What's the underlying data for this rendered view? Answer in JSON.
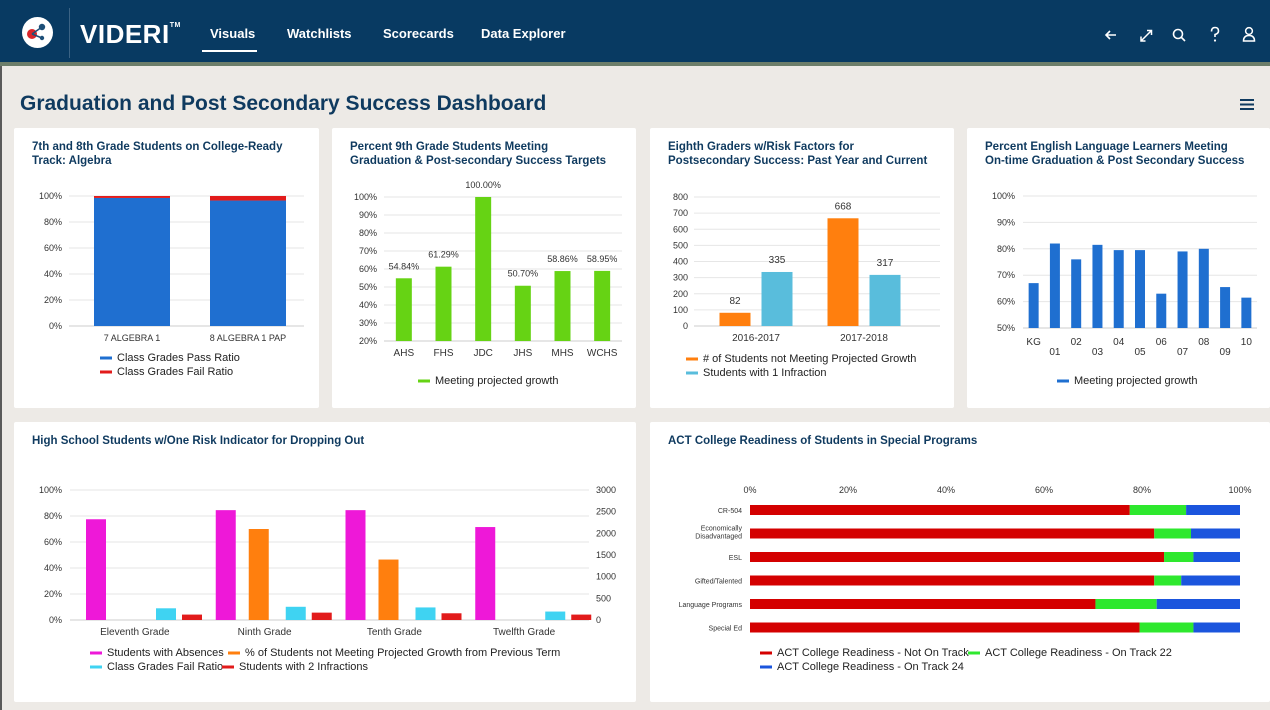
{
  "app": {
    "brand": "VIDERI",
    "trademark": "TM"
  },
  "nav": {
    "items": [
      "Visuals",
      "Watchlists",
      "Scorecards",
      "Data Explorer"
    ],
    "active": "Visuals"
  },
  "toolbar_icons": [
    "back-arrow-icon",
    "expand-icon",
    "search-icon",
    "help-icon",
    "user-icon"
  ],
  "page": {
    "title": "Graduation and Post Secondary Success Dashboard"
  },
  "colors": {
    "nav_bg": "#083a62",
    "blue": "#1f6fd0",
    "red": "#e21b1b",
    "green": "#66d314",
    "orange": "#ff7f0e",
    "teal": "#59bddc",
    "magenta": "#ee18d8",
    "cyan": "#3fd3f2"
  },
  "cards": {
    "algebra": {
      "title_lines": [
        "7th and 8th Grade Students on College-Ready",
        "Track: Algebra"
      ]
    },
    "ninth": {
      "title_lines": [
        "Percent 9th Grade Students Meeting",
        "Graduation & Post-secondary Success Targets"
      ]
    },
    "eighth": {
      "title_lines": [
        "Eighth Graders w/Risk Factors for",
        "Postsecondary Success: Past Year and Current"
      ]
    },
    "ell": {
      "title_lines": [
        "Percent English Language Learners Meeting",
        "On-time Graduation & Post Secondary Success"
      ]
    },
    "dropout": {
      "title_lines": [
        "High School Students w/One Risk Indicator for Dropping Out"
      ]
    },
    "act": {
      "title_lines": [
        "ACT College Readiness of Students in Special Programs"
      ]
    }
  },
  "chart_data": [
    {
      "id": "algebra",
      "type": "bar",
      "stacked": true,
      "categories": [
        "7 ALGEBRA 1",
        "8 ALGEBRA 1 PAP"
      ],
      "series": [
        {
          "name": "Class Grades Pass Ratio",
          "color": "#1f6fd0",
          "values": [
            98.5,
            96.5
          ]
        },
        {
          "name": "Class Grades Fail Ratio",
          "color": "#e21b1b",
          "values": [
            1.5,
            3.5
          ]
        }
      ],
      "ylim": [
        0,
        100
      ],
      "yticks": [
        "100%",
        "80%",
        "60%",
        "40%",
        "20%",
        "0%"
      ],
      "legend": "bottom"
    },
    {
      "id": "ninth",
      "type": "bar",
      "categories": [
        "AHS",
        "FHS",
        "JDC",
        "JHS",
        "MHS",
        "WCHS"
      ],
      "series": [
        {
          "name": "Meeting projected growth",
          "color": "#66d314",
          "values": [
            54.84,
            61.29,
            100.0,
            50.7,
            58.86,
            58.95
          ]
        }
      ],
      "data_labels": [
        "54.84%",
        "61.29%",
        "100.00%",
        "50.70%",
        "58.86%",
        "58.95%"
      ],
      "ylim": [
        20,
        100
      ],
      "yticks": [
        "100%",
        "90%",
        "80%",
        "70%",
        "60%",
        "50%",
        "40%",
        "30%",
        "20%"
      ],
      "legend": "bottom"
    },
    {
      "id": "eighth",
      "type": "bar",
      "categories": [
        "2016-2017",
        "2017-2018"
      ],
      "series": [
        {
          "name": "# of Students not Meeting Projected Growth",
          "color": "#ff7f0e",
          "values": [
            82,
            668
          ]
        },
        {
          "name": "Students with 1 Infraction",
          "color": "#59bddc",
          "values": [
            335,
            317
          ]
        }
      ],
      "data_labels": [
        [
          "82",
          "668"
        ],
        [
          "335",
          "317"
        ]
      ],
      "ylim": [
        0,
        800
      ],
      "yticks": [
        "800",
        "700",
        "600",
        "500",
        "400",
        "300",
        "200",
        "100",
        "0"
      ],
      "legend": "bottom"
    },
    {
      "id": "ell",
      "type": "bar",
      "categories": [
        "KG",
        "01",
        "02",
        "03",
        "04",
        "05",
        "06",
        "07",
        "08",
        "09",
        "10"
      ],
      "series": [
        {
          "name": "Meeting projected growth",
          "color": "#1f6fd0",
          "values": [
            67,
            82,
            76,
            81.5,
            79.5,
            79.5,
            63,
            79,
            80,
            65.5,
            61.5
          ]
        }
      ],
      "ylim": [
        50,
        100
      ],
      "yticks": [
        "100%",
        "90%",
        "80%",
        "70%",
        "60%",
        "50%"
      ],
      "legend": "bottom"
    },
    {
      "id": "dropout",
      "type": "bar",
      "categories": [
        "Eleventh Grade",
        "Ninth Grade",
        "Tenth Grade",
        "Twelfth Grade"
      ],
      "series": [
        {
          "name": "Students with Absences",
          "color": "#ee18d8",
          "axis": "left",
          "values": [
            77.5,
            84.5,
            84.5,
            71.5
          ]
        },
        {
          "name": "% of Students not Meeting Projected Growth from Previous Term",
          "color": "#ff7f0e",
          "axis": "left",
          "values": [
            0,
            70,
            46.5,
            0
          ]
        },
        {
          "name": "Class Grades Fail Ratio",
          "color": "#3fd3f2",
          "axis": "right",
          "values": [
            270,
            305,
            290,
            195
          ]
        },
        {
          "name": "Students with 2 Infractions",
          "color": "#e21b1b",
          "axis": "right",
          "values": [
            125,
            170,
            155,
            125
          ]
        }
      ],
      "ylim": [
        0,
        100
      ],
      "yticks": [
        "100%",
        "80%",
        "60%",
        "40%",
        "20%",
        "0%"
      ],
      "y2lim": [
        0,
        3000
      ],
      "y2ticks": [
        "3000",
        "2500",
        "2000",
        "1500",
        "1000",
        "500",
        "0"
      ],
      "legend": "bottom"
    },
    {
      "id": "act",
      "type": "bar",
      "orientation": "horizontal",
      "stacked": true,
      "categories": [
        "CR-504",
        "Economically Disadvantaged",
        "ESL",
        "Gifted/Talented",
        "Language Programs",
        "Special Ed"
      ],
      "series": [
        {
          "name": "ACT College Readiness - Not On Track",
          "color": "#d40000",
          "values": [
            77.5,
            82.5,
            84.5,
            82.5,
            70.5,
            79.5
          ]
        },
        {
          "name": "ACT College Readiness - On Track 22",
          "color": "#2ee82e",
          "values": [
            11.5,
            7.5,
            6.0,
            5.5,
            12.5,
            11.0
          ]
        },
        {
          "name": "ACT College Readiness - On Track 24",
          "color": "#1b55dd",
          "values": [
            11.0,
            10.0,
            9.5,
            12.0,
            17.0,
            9.5
          ]
        }
      ],
      "xlim": [
        0,
        100
      ],
      "xticks": [
        "0%",
        "20%",
        "40%",
        "60%",
        "80%",
        "100%"
      ],
      "legend": "bottom"
    }
  ]
}
